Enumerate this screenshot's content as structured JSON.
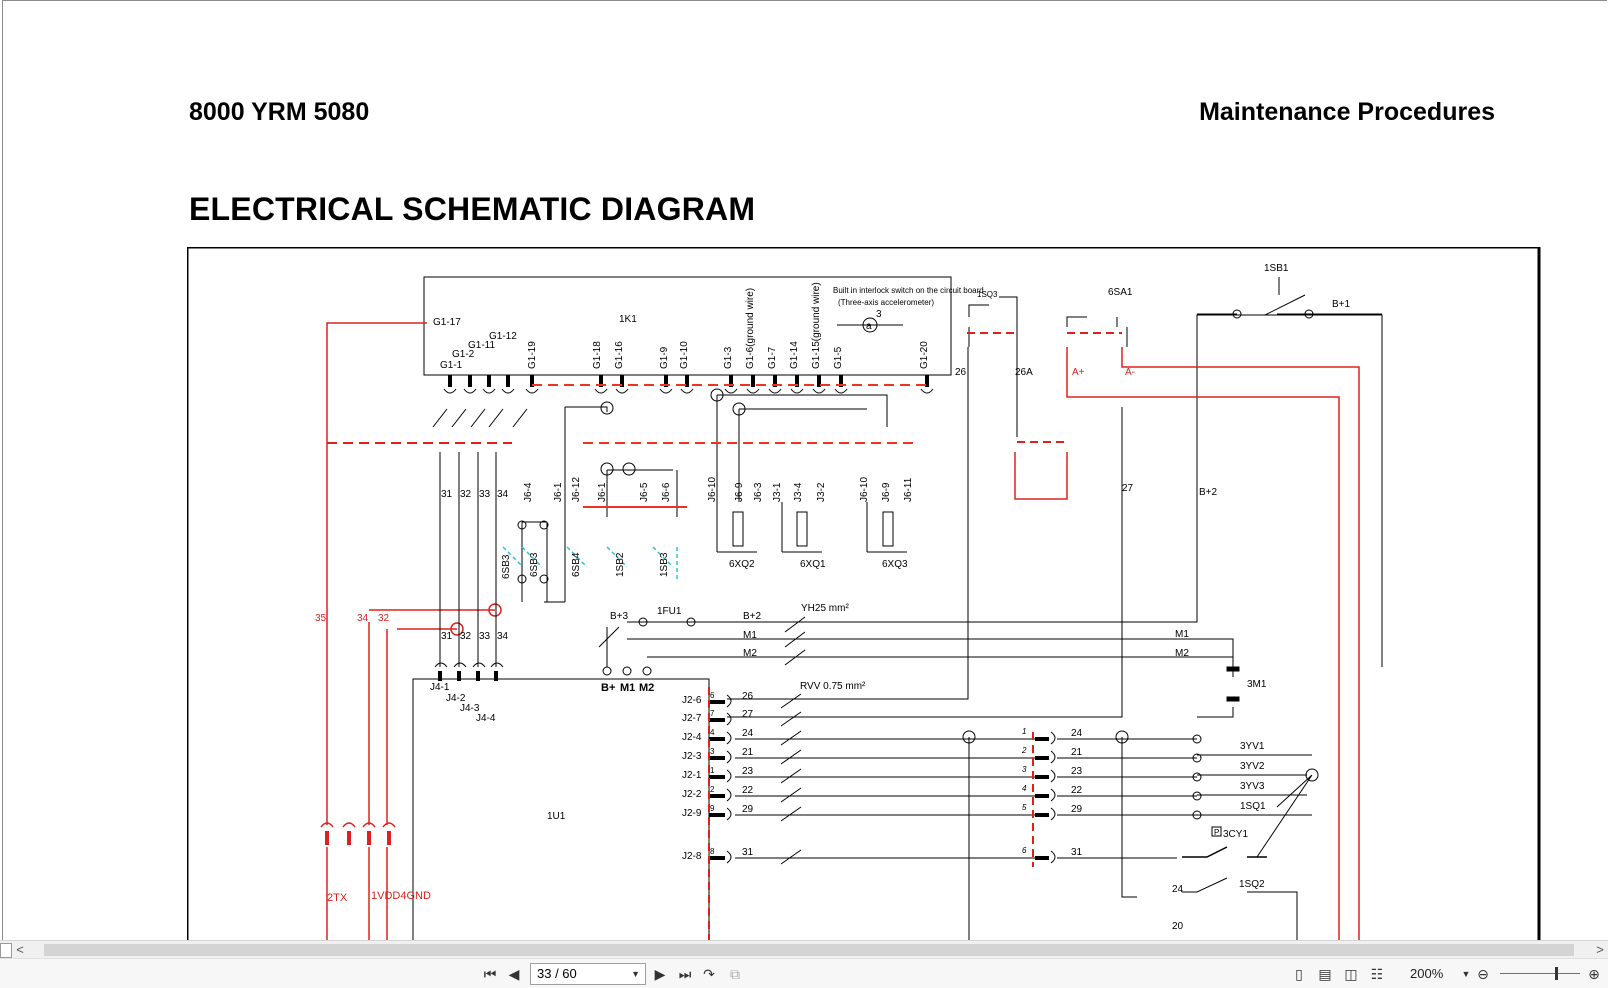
{
  "document": {
    "code": "8000 YRM 5080",
    "section": "Maintenance Procedures",
    "title": "ELECTRICAL SCHEMATIC DIAGRAM"
  },
  "schematic": {
    "controller_top": {
      "name": "1K1",
      "note_line1": "Built in interlock switch on the circuit board",
      "note_line2": "(Three-axis accelerometer)",
      "note_symbol": "a",
      "note_num": "3",
      "pins": [
        "G1-17",
        "G1-1",
        "G1-2",
        "G1-11",
        "G1-12",
        "G1-19",
        "G1-18",
        "G1-16",
        "G1-9",
        "G1-10",
        "G1-3",
        "G1-6(ground wire)",
        "G1-7",
        "G1-14",
        "G1-15(ground wire)",
        "G1-5",
        "G1-20"
      ]
    },
    "connectors": {
      "j6_labels": [
        "J6-4",
        "J6-1",
        "J6-12",
        "J6-1",
        "J6-5",
        "J6-6",
        "J6-10",
        "J6-9",
        "J6-3",
        "J3-1",
        "J3-4",
        "J3-2",
        "J6-10",
        "J6-9",
        "J6-11"
      ],
      "j4_labels": [
        "J4-1",
        "J4-2",
        "J4-3",
        "J4-4"
      ],
      "j2_labels": [
        "J2-6",
        "J2-7",
        "J2-4",
        "J2-3",
        "J2-1",
        "J2-2",
        "J2-9",
        "J2-8"
      ],
      "j2_pin_nums": [
        "6",
        "7",
        "4",
        "3",
        "1",
        "2",
        "9",
        "8"
      ],
      "j2_wires": [
        "26",
        "27",
        "24",
        "21",
        "23",
        "22",
        "29",
        "31"
      ],
      "right_pin_nums": [
        "1",
        "2",
        "3",
        "4",
        "5",
        "6"
      ],
      "right_wires": [
        "24",
        "21",
        "23",
        "22",
        "29",
        "31"
      ]
    },
    "wires": {
      "w31": "31",
      "w32": "32",
      "w33": "33",
      "w34": "34",
      "w35r": "35",
      "w34r": "34",
      "w32r": "32",
      "w26": "26",
      "w26a": "26A",
      "w27": "27",
      "ap": "A+",
      "am": "A-",
      "b1": "B+1",
      "b2": "B+2",
      "b2mid": "B+2",
      "b3": "B+3",
      "m1": "M1",
      "m2": "M2",
      "m1r": "M1",
      "m2r": "M2",
      "bp": "B+",
      "mm1": "M1",
      "mm2": "M2",
      "cable1": "YH25 mm²",
      "cable2": "RVV 0.75 mm²",
      "w24b": "24",
      "w20": "20"
    },
    "components": {
      "k1u": "1U1",
      "sb6": "6SB3",
      "sb6b": "6SB3",
      "sb4": "6SB4",
      "sb2": "1SB2",
      "sb3": "1SB3",
      "xq2": "6XQ2",
      "xq1": "6XQ1",
      "xq3": "6XQ3",
      "sq3": "1SQ3",
      "sa1": "6SA1",
      "sb1": "1SB1",
      "fu1": "1FU1",
      "m3": "3M1",
      "yv1": "3YV1",
      "yv2": "3YV2",
      "yv3": "3YV3",
      "sq1": "1SQ1",
      "cy1": "3CY1",
      "sq2": "1SQ2",
      "tx": "2TX",
      "vdd": "1VDD4GND",
      "p": "P"
    }
  },
  "viewer": {
    "page_indicator": "33 / 60",
    "zoom": "200%",
    "scroll_left": "<",
    "scroll_right": ">"
  }
}
